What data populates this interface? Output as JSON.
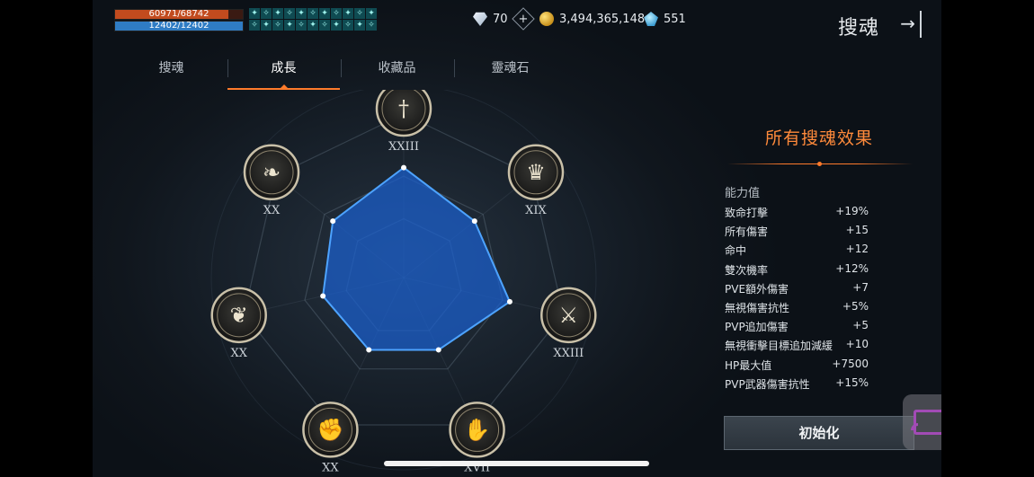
{
  "status": {
    "hp_text": "60971/68742",
    "hp_ratio": 0.887,
    "mp_text": "12402/12402",
    "mp_ratio": 1.0
  },
  "buffs": [
    "✦",
    "✧",
    "✦",
    "✧",
    "✦",
    "✧",
    "✦",
    "✧",
    "✦",
    "✧",
    "✦",
    "✧",
    "✦",
    "✧",
    "✦",
    "✧",
    "✦",
    "✧",
    "✦",
    "✧",
    "✦",
    "✧"
  ],
  "currency": {
    "diamond": "70",
    "gold": "3,494,365,148",
    "crystal": "551"
  },
  "header": {
    "title": "搜魂",
    "exit_glyph": "→"
  },
  "tabs": [
    {
      "label": "搜魂"
    },
    {
      "label": "成長"
    },
    {
      "label": "收藏品"
    },
    {
      "label": "靈魂石"
    }
  ],
  "active_tab": 1,
  "radar": {
    "levels": [
      "XXIII",
      "XIX",
      "XXIII",
      "XVII",
      "XX",
      "XX",
      "XX"
    ],
    "icons": [
      "sword-emblem-icon",
      "crown-flower-emblem-icon",
      "tri-sword-emblem-icon",
      "open-hand-emblem-icon",
      "fist-emblem-icon",
      "wing-claw-emblem-icon",
      "feather-emblem-icon"
    ],
    "values": [
      0.85,
      0.7,
      0.84,
      0.62,
      0.62,
      0.64,
      0.7
    ],
    "fill_color": "#1a5fcf",
    "stroke_color": "#4da3ff"
  },
  "panel": {
    "title": "所有搜魂效果",
    "heading": "能力值",
    "stats": [
      {
        "name": "致命打擊",
        "value": "+19%"
      },
      {
        "name": "所有傷害",
        "value": "+15"
      },
      {
        "name": "命中",
        "value": "+12"
      },
      {
        "name": "雙次機率",
        "value": "+12%"
      },
      {
        "name": "PVE額外傷害",
        "value": "+7"
      },
      {
        "name": "無視傷害抗性",
        "value": "+5%"
      },
      {
        "name": "PVP追加傷害",
        "value": "+5"
      },
      {
        "name": "無視衝擊目標追加減緩",
        "value": "+10"
      },
      {
        "name": "HP最大值",
        "value": "+7500"
      },
      {
        "name": "PVP武器傷害抗性",
        "value": "+15%"
      }
    ],
    "reset_label": "初始化"
  },
  "colors": {
    "accent": "#ff8a3b",
    "hp": "#c24b1e",
    "mp": "#2f7cc4"
  }
}
